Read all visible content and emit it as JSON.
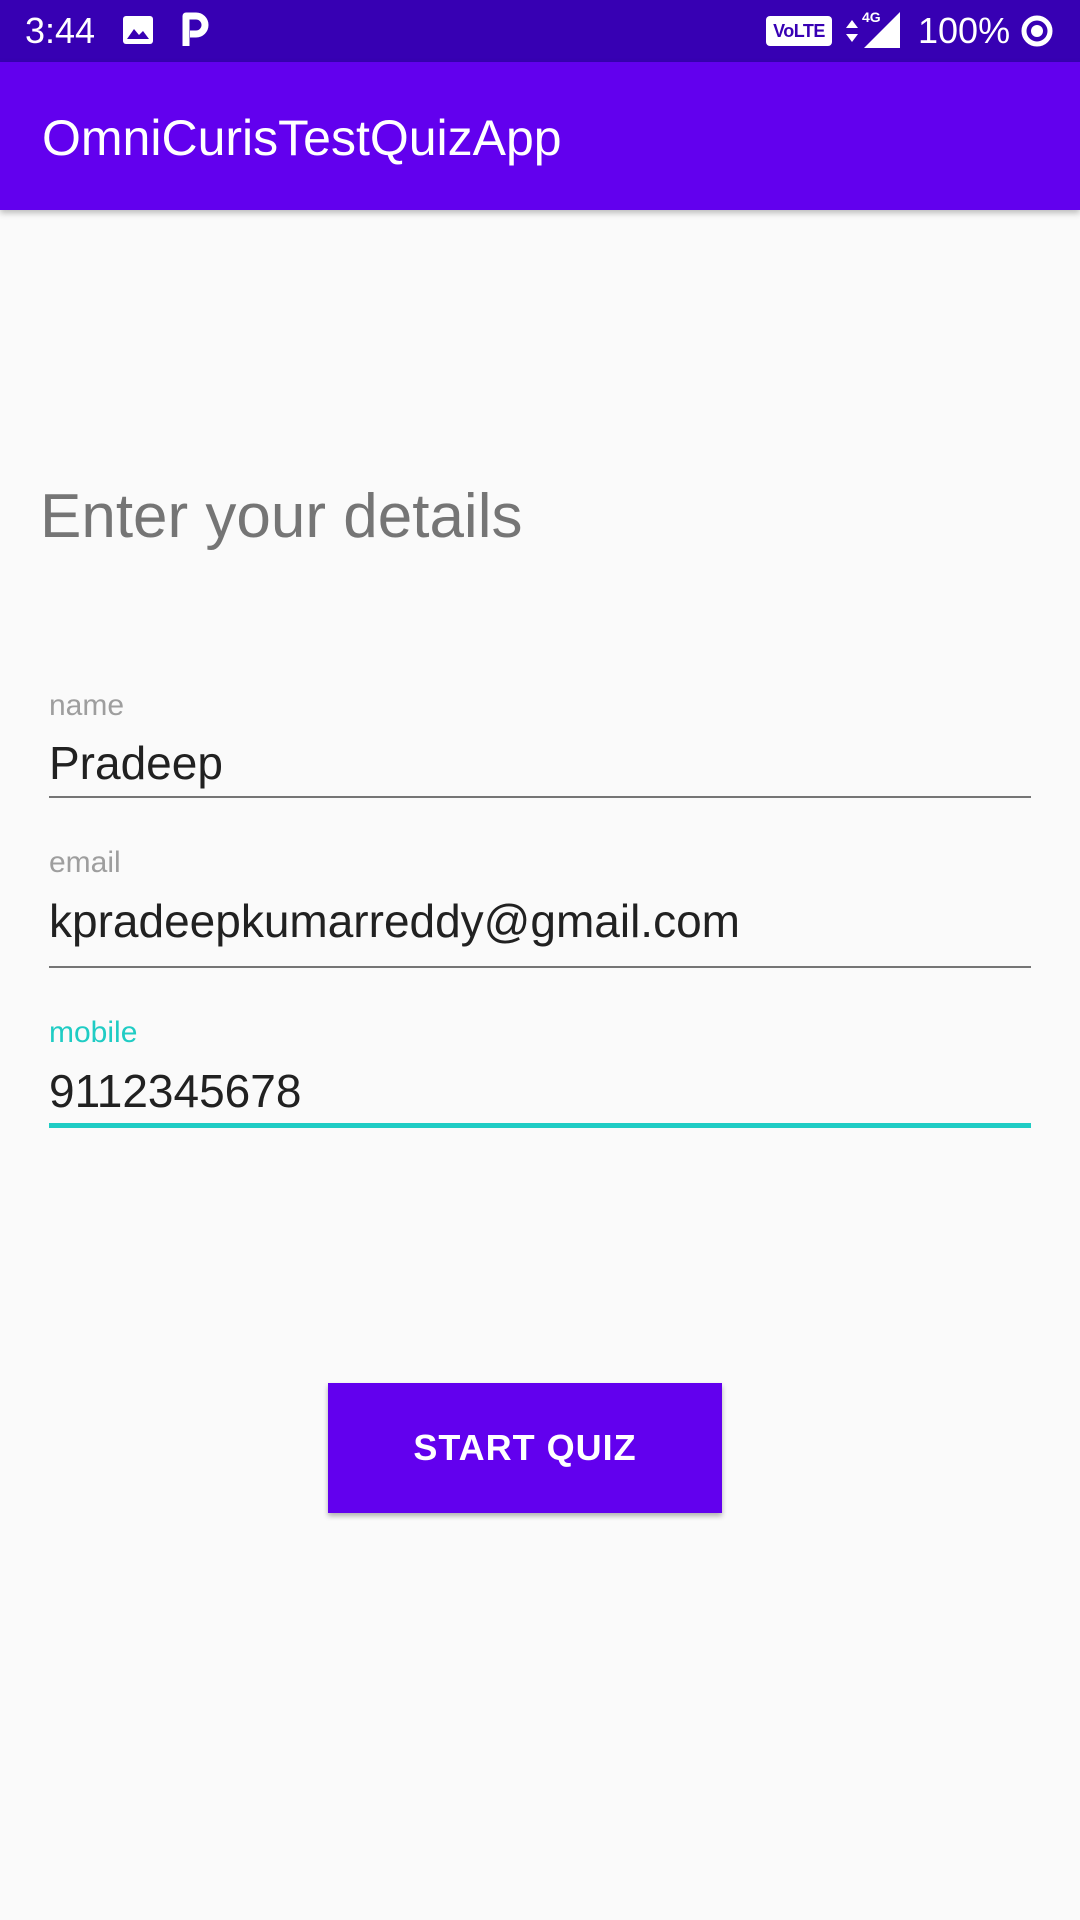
{
  "status_bar": {
    "time": "3:44",
    "network_badge": "VoLTE",
    "network_type": "4G",
    "battery": "100%",
    "icons": [
      "image-icon",
      "parking-icon",
      "volte-icon",
      "data-arrows-icon",
      "signal-icon",
      "battery-saver-icon"
    ]
  },
  "app_bar": {
    "title": "OmniCurisTestQuizApp"
  },
  "form": {
    "heading": "Enter your details",
    "fields": [
      {
        "label": "name",
        "value": "Pradeep"
      },
      {
        "label": "email",
        "value": "kpradeepkumarreddy@gmail.com"
      },
      {
        "label": "mobile",
        "value": "9112345678"
      }
    ],
    "focused_field": "mobile",
    "submit_label": "START QUIZ"
  },
  "colors": {
    "status_bar": "#3700B3",
    "primary": "#6200EE",
    "accent": "#1FCCC4",
    "background": "#FAFAFA"
  }
}
